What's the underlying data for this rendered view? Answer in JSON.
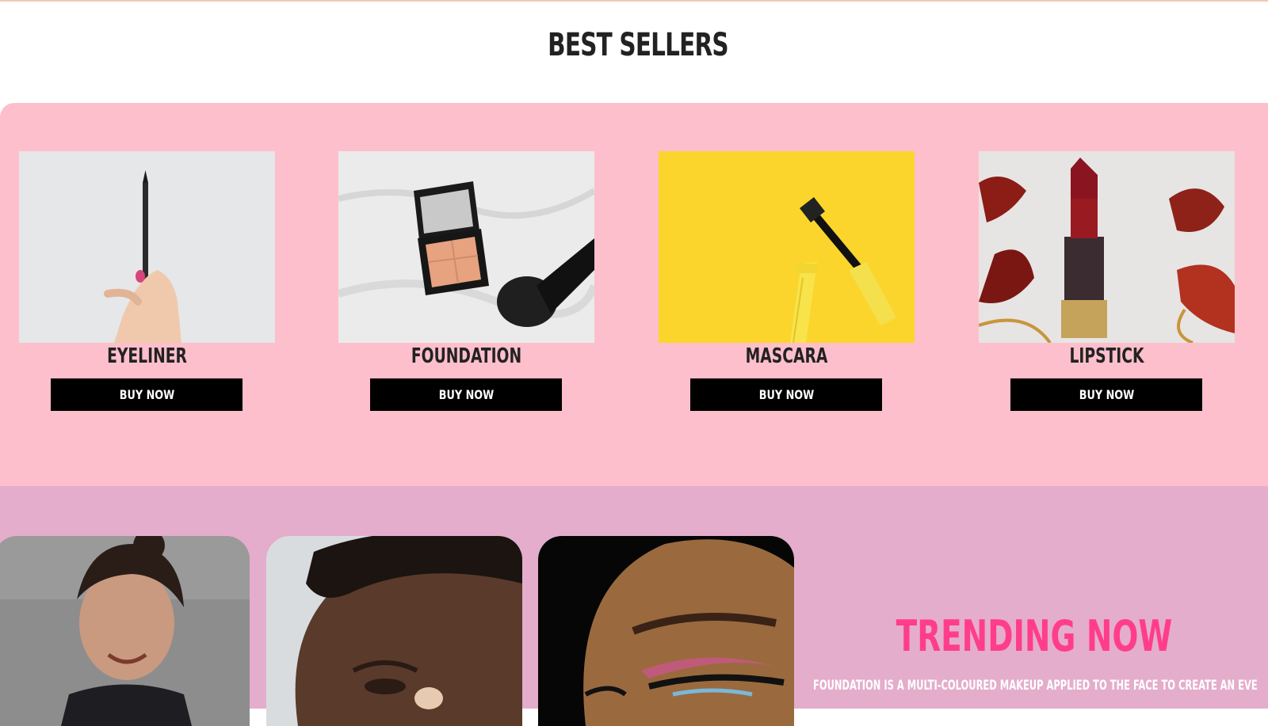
{
  "best_sellers": {
    "title": "BEST SELLERS",
    "products": [
      {
        "name": "EYELINER",
        "button_label": "BUY NOW"
      },
      {
        "name": "FOUNDATION",
        "button_label": "BUY NOW"
      },
      {
        "name": "MASCARA",
        "button_label": "BUY NOW"
      },
      {
        "name": "LIPSTICK",
        "button_label": "BUY NOW"
      }
    ]
  },
  "trending": {
    "title": "TRENDING NOW",
    "description": "FOUNDATION IS A MULTI-COLOURED MAKEUP APPLIED TO THE FACE TO CREATE AN EVE"
  },
  "colors": {
    "best_sellers_bg": "#fdbfcb",
    "trending_bg": "#e4adcb",
    "trending_title": "#ff3d8b",
    "button_bg": "#000000"
  }
}
